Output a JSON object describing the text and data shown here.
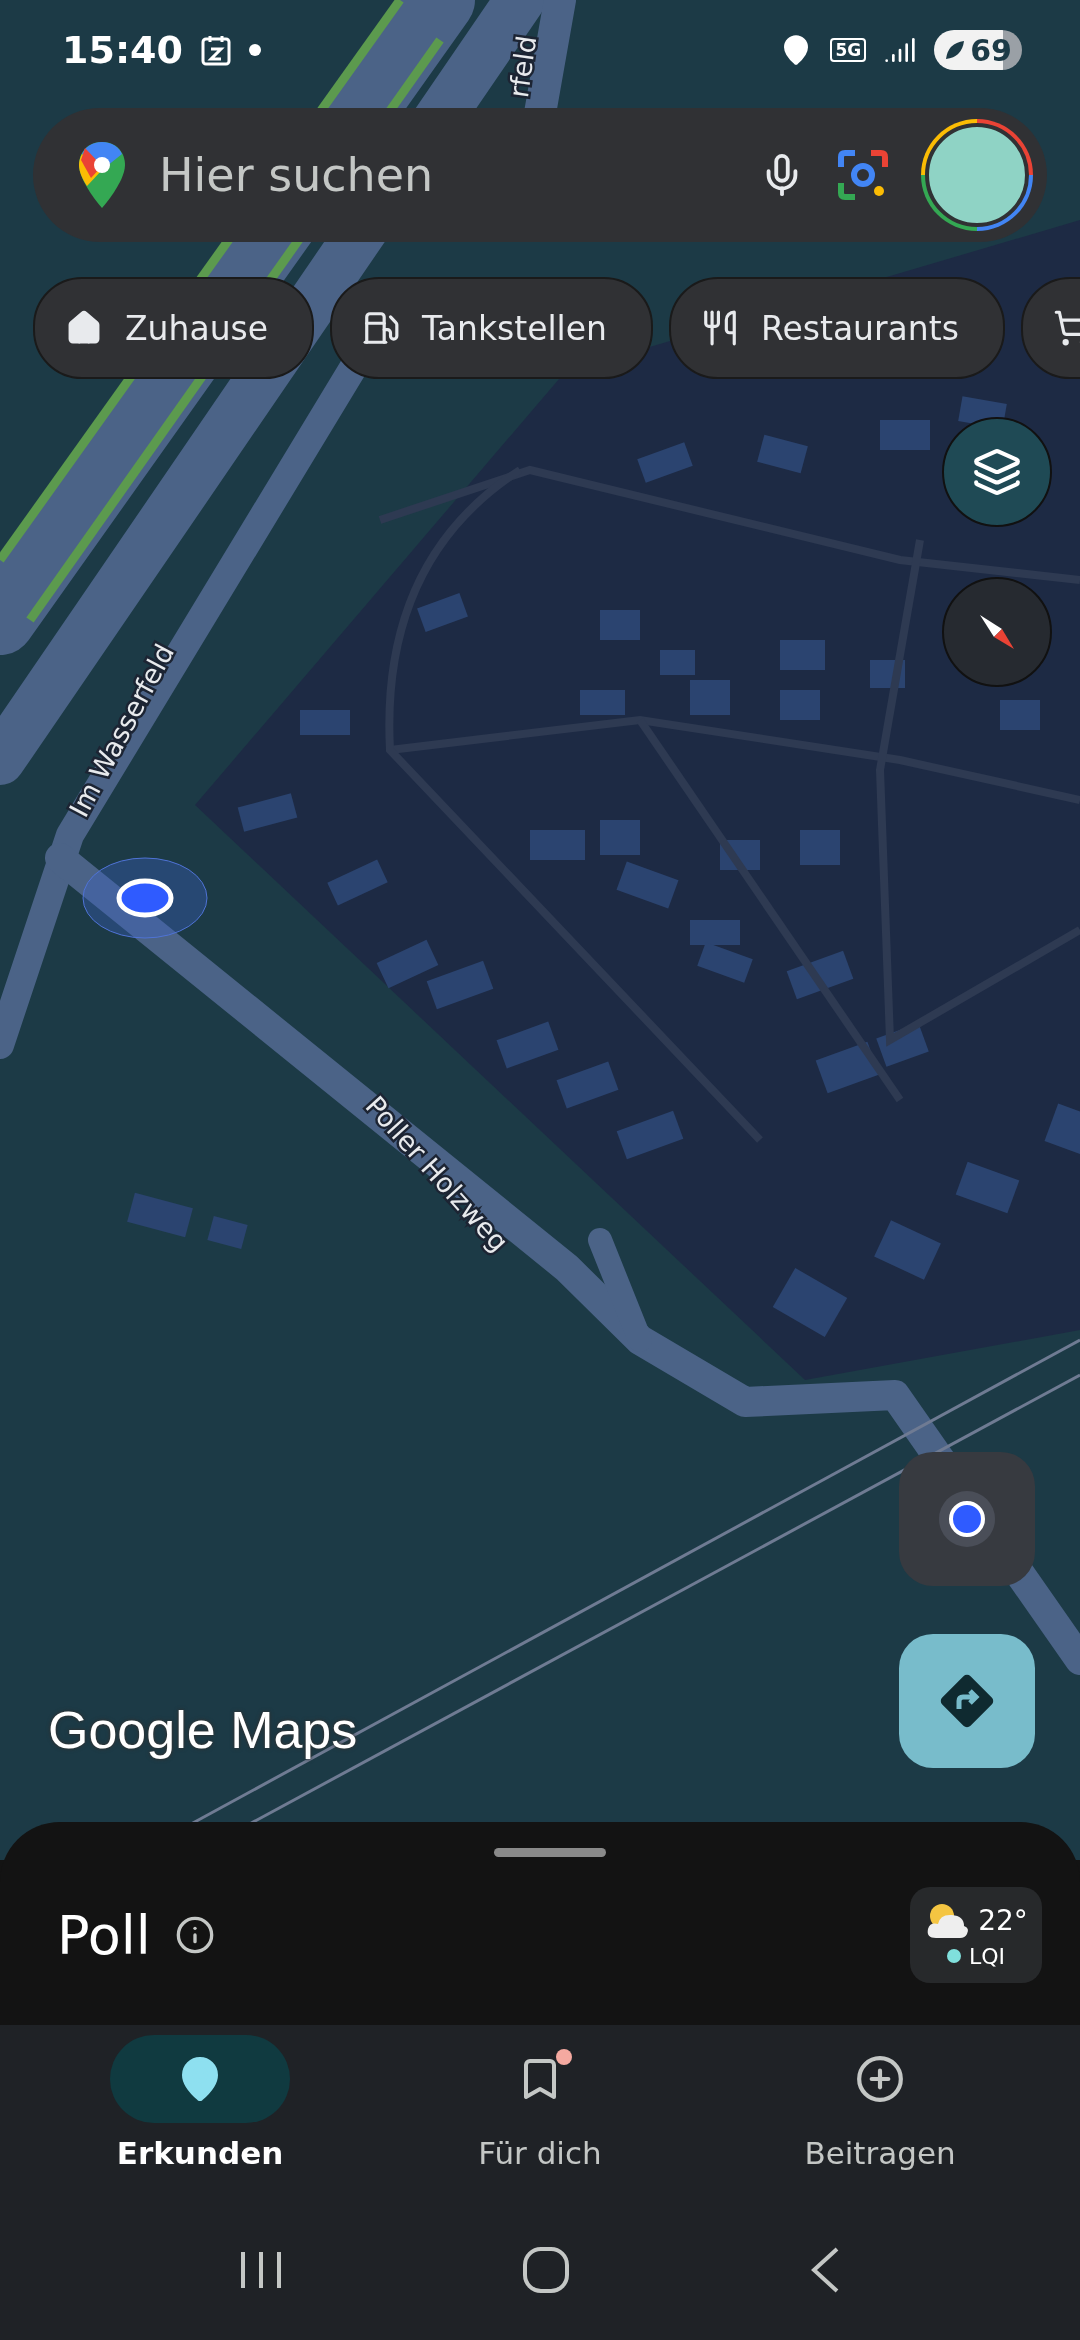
{
  "status_bar": {
    "time": "15:40",
    "network": "5G",
    "battery": "69"
  },
  "search": {
    "placeholder": "Hier suchen"
  },
  "chips": [
    {
      "kind": "labeled",
      "label": "Zuhause"
    },
    {
      "kind": "labeled",
      "label": "Tankstellen"
    },
    {
      "kind": "labeled",
      "label": "Restaurants"
    },
    {
      "kind": "icon"
    }
  ],
  "map": {
    "street_labels": [
      {
        "text": "Im Wasserfeld"
      },
      {
        "text": "Poller Holzweg"
      },
      {
        "text": "rfeld"
      }
    ],
    "logo": "Google Maps"
  },
  "place": {
    "name": "Poll",
    "weather": {
      "temperature": "22°",
      "air_quality": "LQI"
    }
  },
  "nav": [
    {
      "label": "Erkunden",
      "selected": true,
      "notification": false
    },
    {
      "label": "Für dich",
      "selected": false,
      "notification": true
    },
    {
      "label": "Beitragen",
      "selected": false,
      "notification": false
    }
  ]
}
